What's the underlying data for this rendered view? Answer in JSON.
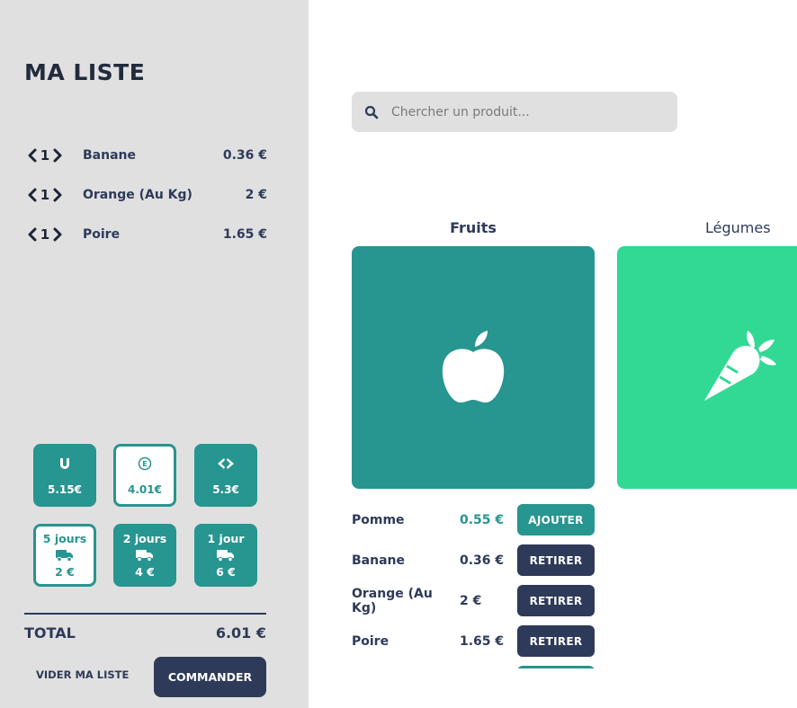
{
  "sidebar": {
    "title": "MA LISTE",
    "items": [
      {
        "qty": "1",
        "name": "Banane",
        "price": "0.36 €"
      },
      {
        "qty": "1",
        "name": "Orange (Au Kg)",
        "price": "2 €"
      },
      {
        "qty": "1",
        "name": "Poire",
        "price": "1.65 €"
      }
    ],
    "stores": [
      {
        "logo": "U",
        "icon": "magasins-u-logo-icon",
        "price": "5.15€",
        "selected": false
      },
      {
        "logo": "E",
        "icon": "leclerc-logo-icon",
        "price": "4.01€",
        "selected": true
      },
      {
        "logo": "C",
        "icon": "carrefour-logo-icon",
        "price": "5.3€",
        "selected": false
      }
    ],
    "deliveries": [
      {
        "delay": "5 jours",
        "icon": "truck-icon",
        "price": "2 €",
        "selected": true
      },
      {
        "delay": "2 jours",
        "icon": "truck-icon",
        "price": "4 €",
        "selected": false
      },
      {
        "delay": "1 jour",
        "icon": "truck-icon",
        "price": "6 €",
        "selected": false
      }
    ],
    "total_label": "TOTAL",
    "total_value": "6.01 €",
    "clear_label": "VIDER MA LISTE",
    "order_label": "COMMANDER"
  },
  "search": {
    "placeholder": "Chercher un produit..."
  },
  "categories": [
    {
      "title": "Fruits",
      "icon": "apple-icon",
      "active": true
    },
    {
      "title": "Légumes",
      "icon": "carrot-icon",
      "active": false
    }
  ],
  "products": [
    {
      "name": "Pomme",
      "price": "0.55 €",
      "action": "AJOUTER",
      "in_list": false
    },
    {
      "name": "Banane",
      "price": "0.36 €",
      "action": "RETIRER",
      "in_list": true
    },
    {
      "name": "Orange (Au Kg)",
      "price": "2 €",
      "action": "RETIRER",
      "in_list": true
    },
    {
      "name": "Poire",
      "price": "1.65 €",
      "action": "RETIRER",
      "in_list": true
    }
  ],
  "colors": {
    "teal": "#279590",
    "green": "#32d994",
    "navy": "#2e3a59",
    "sidebar_bg": "#e0e0e0"
  }
}
